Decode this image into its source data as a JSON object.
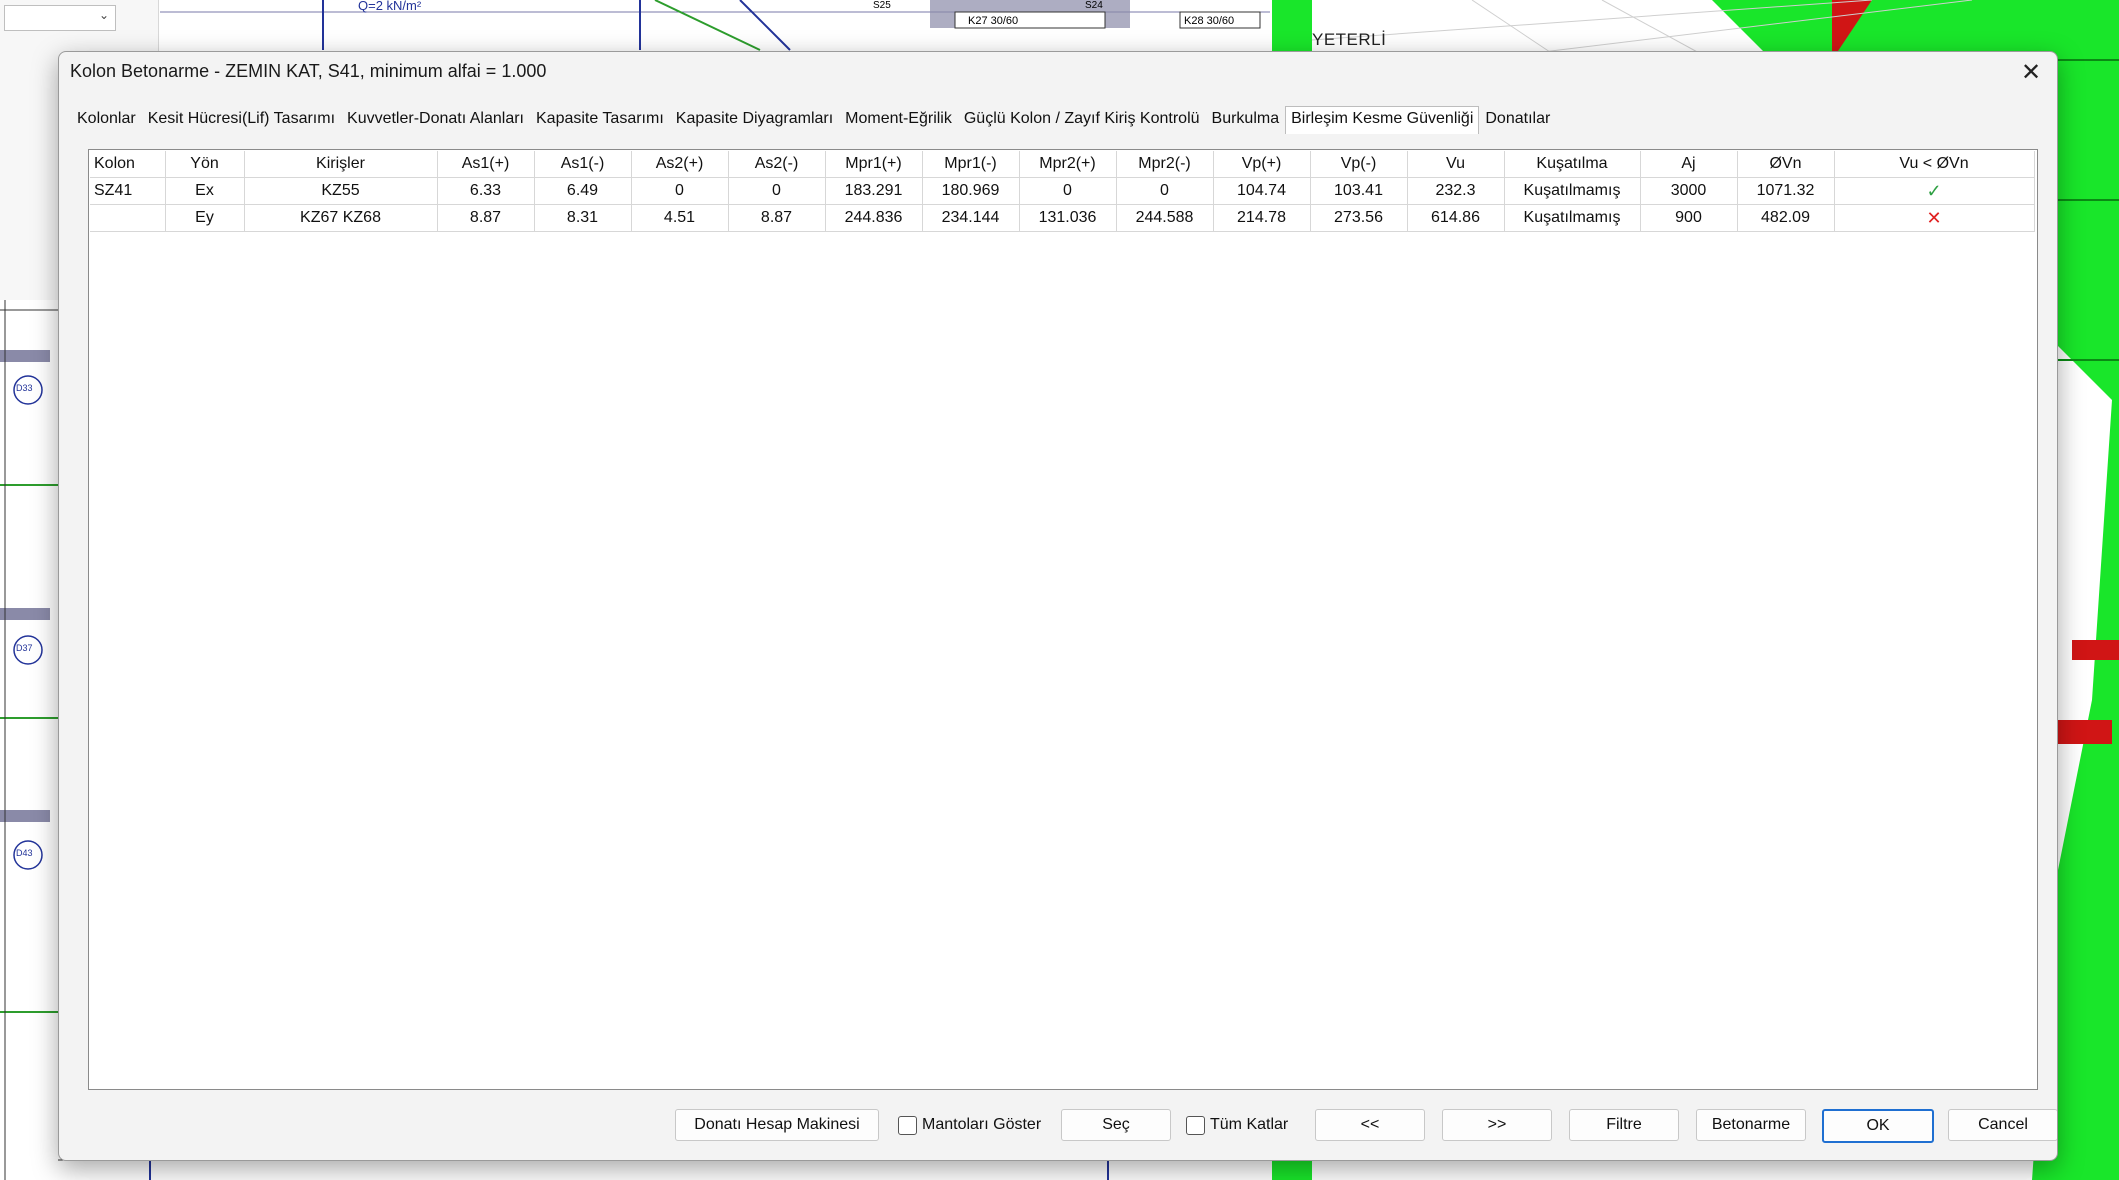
{
  "background": {
    "status_text": "YETERLİ",
    "plan_labels": [
      "S25",
      "S24",
      "K27 30/60",
      "K28 30/60",
      "D33",
      "D37",
      "D43",
      "Q=2 kN/m²"
    ]
  },
  "dialog": {
    "title": "Kolon Betonarme - ZEMIN KAT, S41, minimum alfai = 1.000",
    "close_icon": "close-icon",
    "tabs": [
      {
        "label": "Kolonlar"
      },
      {
        "label": "Kesit Hücresi(Lif) Tasarımı"
      },
      {
        "label": "Kuvvetler-Donatı Alanları"
      },
      {
        "label": "Kapasite Tasarımı"
      },
      {
        "label": "Kapasite Diyagramları"
      },
      {
        "label": "Moment-Eğrilik"
      },
      {
        "label": "Güçlü Kolon / Zayıf Kiriş Kontrolü"
      },
      {
        "label": "Burkulma"
      },
      {
        "label": "Birleşim Kesme Güvenliği"
      },
      {
        "label": "Donatılar"
      }
    ],
    "active_tab_index": 8,
    "table": {
      "headers": [
        "Kolon",
        "Yön",
        "Kirişler",
        "As1(+)",
        "As1(-)",
        "As2(+)",
        "As2(-)",
        "Mpr1(+)",
        "Mpr1(-)",
        "Mpr2(+)",
        "Mpr2(-)",
        "Vp(+)",
        "Vp(-)",
        "Vu",
        "Kuşatılma",
        "Aj",
        "ØVn",
        "Vu < ØVn"
      ],
      "rows": [
        {
          "kolon": "SZ41",
          "yon": "Ex",
          "kirisler": "KZ55",
          "as1p": "6.33",
          "as1m": "6.49",
          "as2p": "0",
          "as2m": "0",
          "mpr1p": "183.291",
          "mpr1m": "180.969",
          "mpr2p": "0",
          "mpr2m": "0",
          "vpp": "104.74",
          "vpm": "103.41",
          "vu": "232.3",
          "kusatilma": "Kuşatılmamış",
          "aj": "3000",
          "ovn": "1071.32",
          "result": "✓",
          "result_icon": "check-icon",
          "result_color": "#2ea043"
        },
        {
          "kolon": "",
          "yon": "Ey",
          "kirisler": "KZ67 KZ68",
          "as1p": "8.87",
          "as1m": "8.31",
          "as2p": "4.51",
          "as2m": "8.87",
          "mpr1p": "244.836",
          "mpr1m": "234.144",
          "mpr2p": "131.036",
          "mpr2m": "244.588",
          "vpp": "214.78",
          "vpm": "273.56",
          "vu": "614.86",
          "kusatilma": "Kuşatılmamış",
          "aj": "900",
          "ovn": "482.09",
          "result": "✕",
          "result_icon": "cross-icon",
          "result_color": "#e02020"
        }
      ]
    },
    "footer": {
      "calc_button": "Donatı Hesap Makinesi",
      "mantolar_checkbox": "Mantoları Göster",
      "mantolar_checked": false,
      "sec_button": "Seç",
      "tum_katlar_checkbox": "Tüm Katlar",
      "tum_katlar_checked": false,
      "prev_button": "<<",
      "next_button": ">>",
      "filtre_button": "Filtre",
      "betonarme_button": "Betonarme",
      "ok_button": "OK",
      "cancel_button": "Cancel"
    }
  }
}
